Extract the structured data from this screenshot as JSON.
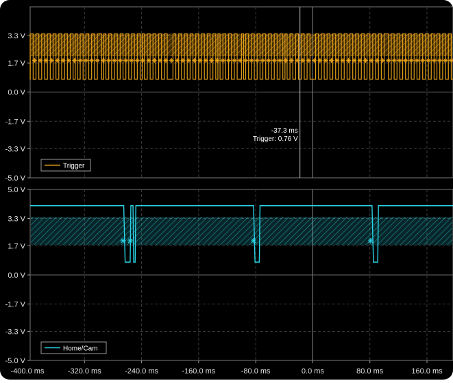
{
  "chart_data": [
    {
      "type": "line",
      "title": "",
      "series": [
        {
          "name": "Trigger",
          "color": "#e8a21a",
          "levels": {
            "high": 3.4,
            "low": 0.75
          },
          "transitions_ms": [
            -412,
            -409,
            -406,
            -404,
            -400,
            -398,
            -396,
            -392,
            -388,
            -384,
            -380,
            -376,
            -372,
            -368,
            -364,
            -360,
            -356,
            -352,
            -348,
            -344,
            -340,
            -336,
            -333,
            -330,
            -326,
            -322,
            -318,
            -314,
            -310,
            -306,
            -302,
            -296,
            -293,
            -290,
            -286,
            -282,
            -278,
            -274,
            -270,
            -266,
            -262,
            -258,
            -254,
            -250,
            -246,
            -242,
            -239,
            -236,
            -232,
            -228,
            -224,
            -220,
            -216,
            -212,
            -208,
            -204,
            -196,
            -192,
            -188,
            -184,
            -180,
            -176,
            -172,
            -168,
            -164,
            -160,
            -156,
            -152,
            -148,
            -144,
            -140,
            -136,
            -133,
            -130,
            -126,
            -122,
            -118,
            -114,
            -110,
            -106,
            -100,
            -97,
            -94,
            -90,
            -86,
            -82,
            -78,
            -74,
            -70,
            -66,
            -62,
            -58,
            -54,
            -50,
            -46,
            -42,
            -39,
            -36,
            -32,
            -28,
            -24,
            -20,
            -16,
            -12,
            -8,
            -4,
            4,
            8,
            12,
            16,
            20,
            24,
            28,
            32,
            36,
            40,
            44,
            48,
            52,
            56,
            60,
            64,
            68,
            72,
            76,
            80,
            84,
            88,
            92,
            96,
            100,
            106,
            110,
            114,
            118,
            122,
            126,
            130,
            134,
            138,
            142,
            146,
            150,
            154,
            158,
            162,
            166,
            170,
            174,
            178,
            182,
            186,
            190,
            194
          ]
        }
      ],
      "threshold_band": {
        "color": "#e8a21a",
        "range": [
          2.1,
          3.4
        ]
      },
      "trigger_markers": {
        "v": 1.85,
        "x_ms": [
          -406,
          -398,
          -390,
          -382,
          -374,
          -366,
          -358,
          -350,
          -342,
          -334,
          -326,
          -318,
          -310,
          -302,
          -294,
          -286,
          -278,
          -270,
          -262,
          -254,
          -246,
          -238,
          -230,
          -222,
          -214,
          -206,
          -198,
          -190,
          -182,
          -174,
          -166,
          -158,
          -150,
          -142,
          -134,
          -126,
          -118,
          -110,
          -102,
          -94,
          -86,
          -78,
          -70,
          -62,
          -54,
          -46,
          -38,
          -30,
          -22,
          -14,
          -6,
          2,
          10,
          18,
          26,
          34,
          42,
          50,
          58,
          66,
          74,
          82,
          90,
          98,
          106,
          114,
          122,
          130,
          138,
          146,
          154,
          162,
          170,
          178,
          186,
          194
        ]
      },
      "y_ticks": [
        "3.3 V",
        "1.7 V",
        "0.0 V",
        "-1.7 V",
        "-3.3 V",
        "-5.0 V"
      ],
      "y_tick_values": [
        3.3,
        1.7,
        0.0,
        -1.7,
        -3.3,
        -5.0
      ],
      "ylim": [
        -5.0,
        5.0
      ],
      "cursor": {
        "x_ms": -18,
        "time_label": "-37.3 ms",
        "trigger_label": "Trigger: 0.76 V"
      },
      "legend": "Trigger",
      "grid": true
    },
    {
      "type": "line",
      "title": "",
      "series": [
        {
          "name": "Home/Cam",
          "color": "#2ad4e6",
          "segments": [
            [
              -410,
              4.05
            ],
            [
              -265,
              4.05
            ],
            [
              -263,
              0.75
            ],
            [
              -256,
              0.75
            ],
            [
              -255,
              4.05
            ],
            [
              -252,
              4.05
            ],
            [
              -251,
              0.75
            ],
            [
              -249,
              0.75
            ],
            [
              -248,
              4.05
            ],
            [
              -166,
              4.05
            ],
            [
              -83,
              4.05
            ],
            [
              -81,
              0.75
            ],
            [
              -75,
              0.75
            ],
            [
              -74,
              4.05
            ],
            [
              83,
              4.05
            ],
            [
              85,
              0.75
            ],
            [
              91,
              0.75
            ],
            [
              92,
              4.05
            ],
            [
              200,
              4.05
            ]
          ]
        }
      ],
      "threshold_band": {
        "color": "#2ad4e6",
        "range": [
          1.75,
          3.4
        ]
      },
      "markers": [
        [
          -266,
          2.0
        ],
        [
          -256,
          2.0
        ],
        [
          -83,
          2.0
        ],
        [
          81,
          2.0
        ]
      ],
      "y_ticks": [
        "5.0 V",
        "3.3 V",
        "1.7 V",
        "0.0 V",
        "-1.7 V",
        "-3.3 V",
        "-5.0 V"
      ],
      "y_tick_values": [
        5.0,
        3.3,
        1.7,
        0.0,
        -1.7,
        -3.3,
        -5.0
      ],
      "ylim": [
        -5.0,
        5.0
      ],
      "x_ticks": [
        "-400.0 ms",
        "-320.0 ms",
        "-240.0 ms",
        "-160.0 ms",
        "-80.0 ms",
        "0.0 ms",
        "80.0 ms",
        "160.0 ms"
      ],
      "x_tick_values": [
        -400,
        -320,
        -240,
        -160,
        -80,
        0,
        80,
        160
      ],
      "legend": "Home/Cam",
      "grid": true
    }
  ]
}
